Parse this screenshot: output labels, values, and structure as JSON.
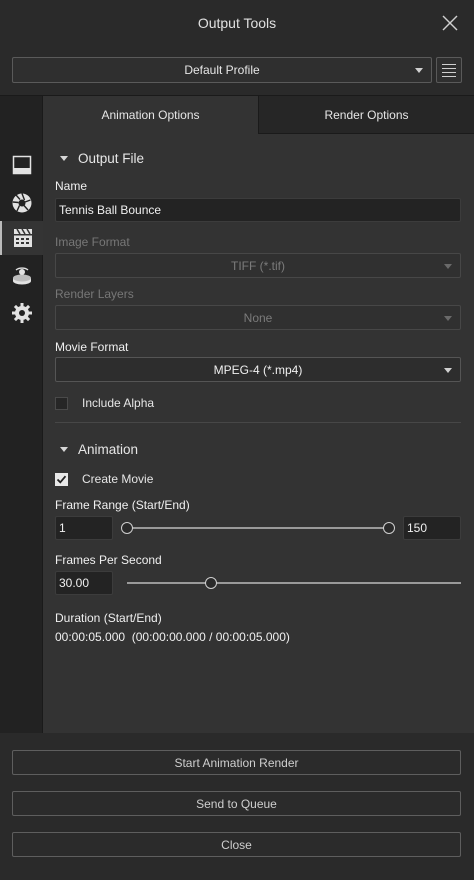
{
  "window": {
    "title": "Output Tools"
  },
  "profile": {
    "selected": "Default Profile"
  },
  "tabs": [
    {
      "label": "Animation Options",
      "active": true
    },
    {
      "label": "Render Options",
      "active": false
    }
  ],
  "output_file": {
    "section_title": "Output File",
    "name_label": "Name",
    "name_value": "Tennis Ball Bounce",
    "image_format_label": "Image Format",
    "image_format_value": "TIFF (*.tif)",
    "render_layers_label": "Render Layers",
    "render_layers_value": "None",
    "movie_format_label": "Movie Format",
    "movie_format_value": "MPEG-4 (*.mp4)",
    "include_alpha_label": "Include Alpha",
    "include_alpha_checked": false
  },
  "animation": {
    "section_title": "Animation",
    "create_movie_label": "Create Movie",
    "create_movie_checked": true,
    "frame_range_label": "Frame Range (Start/End)",
    "frame_start": "1",
    "frame_end": "150",
    "fps_label": "Frames Per Second",
    "fps_value": "30.00",
    "duration_label": "Duration (Start/End)",
    "duration_value": "00:00:05.000  (00:00:00.000 / 00:00:05.000)"
  },
  "buttons": {
    "start_render": "Start Animation Render",
    "send_to_queue": "Send to Queue",
    "close": "Close"
  },
  "colors": {
    "background": "#2a2a2a",
    "panel": "#333333",
    "input": "#232323",
    "text": "#e6e6e6"
  }
}
